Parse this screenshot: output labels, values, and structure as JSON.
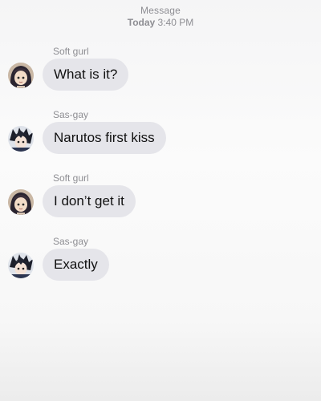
{
  "header": {
    "title": "Message",
    "day": "Today",
    "time": "3:40 PM"
  },
  "messages": [
    {
      "sender": "Soft gurl",
      "text": "What is it?",
      "avatar": "soft-gurl-avatar"
    },
    {
      "sender": "Sas-gay",
      "text": "Narutos first kiss",
      "avatar": "sas-gay-avatar"
    },
    {
      "sender": "Soft gurl",
      "text": "I don’t get it",
      "avatar": "soft-gurl-avatar"
    },
    {
      "sender": "Sas-gay",
      "text": "Exactly",
      "avatar": "sas-gay-avatar"
    }
  ],
  "colors": {
    "bubble": "#e5e5ea",
    "meta_text": "#8e8e93",
    "message_text": "#111111"
  }
}
